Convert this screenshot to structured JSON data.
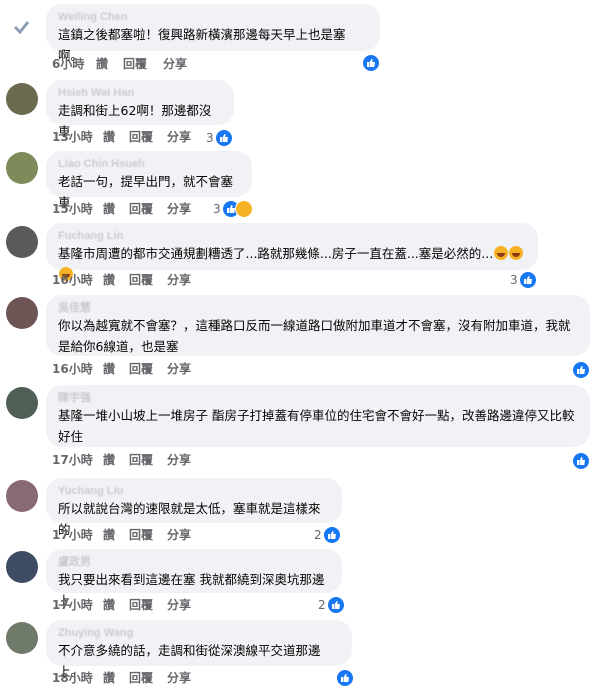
{
  "actions": {
    "reply_a": "讚",
    "reply_b": "回覆",
    "share": "分享"
  },
  "comments": [
    {
      "name": "Weiling Chen",
      "text": "這鎮之後都塞啦！復興路新橫濱那邊每天早上也是塞啊。",
      "time": "6小時",
      "count": ""
    },
    {
      "name": "Hsieh Wei Han",
      "text": "走調和街上62啊！那邊都沒車",
      "time": "13小時",
      "count": "3"
    },
    {
      "name": "Liao Chin Hsueh",
      "text": "老話一句，提早出門，就不會塞車",
      "time": "15小時",
      "count": "3"
    },
    {
      "name": "Fuchang Lin",
      "text": "基隆市周遭的都市交通規劃糟透了...路就那幾條...房子一直在蓋...塞是必然的...",
      "time": "16小時",
      "count": "3"
    },
    {
      "name": "吳佳慧",
      "text": "你以為越寬就不會塞？，這種路口反而一線道路口做附加車道才不會塞，沒有附加車道，我就是給你6線道，也是塞",
      "time": "16小時",
      "count": ""
    },
    {
      "name": "陳宇強",
      "text": "基隆一堆小山坡上一堆房子 酯房子打掉蓋有停車位的住宅會不會好一點，改善路邊違停又比較好住",
      "time": "17小時",
      "count": ""
    },
    {
      "name": "Yuchang Liu",
      "text": "所以就說台灣的速限就是太低，塞車就是這樣來的",
      "time": "17小時",
      "count": "2"
    },
    {
      "name": "盧政男",
      "text": "我只要出來看到這邊在塞 我就都繞到深奧坑那邊上",
      "time": "17小時",
      "count": "2"
    },
    {
      "name": "Zhuying Wang",
      "text": "不介意多繞的話，走調和街從深澳線平交道那邊上。",
      "time": "18小時",
      "count": ""
    }
  ]
}
